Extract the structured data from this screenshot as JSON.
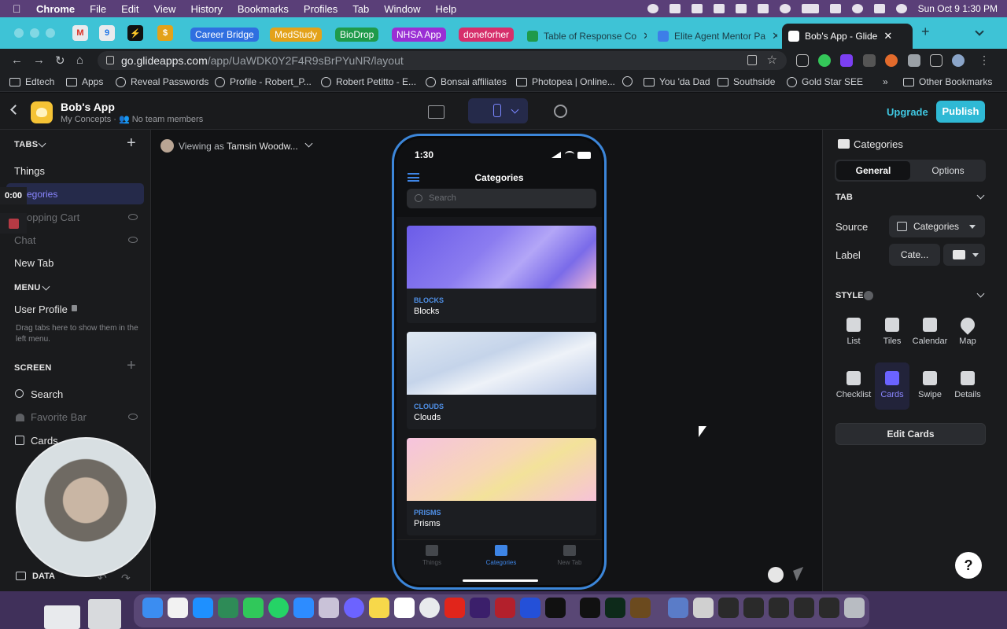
{
  "menubar": {
    "app": "Chrome",
    "items": [
      "File",
      "Edit",
      "View",
      "History",
      "Bookmarks",
      "Profiles",
      "Tab",
      "Window",
      "Help"
    ],
    "datetime": "Sun Oct 9  1:30 PM"
  },
  "tabs": {
    "groups": [
      {
        "label": "Career Bridge",
        "color": "#2f6fe0"
      },
      {
        "label": "MedStudy",
        "color": "#e3a21a"
      },
      {
        "label": "BioDrop",
        "color": "#1f9a4a"
      },
      {
        "label": "NHSA App",
        "color": "#9a2fd4"
      },
      {
        "label": "doneforher",
        "color": "#d62f6b"
      }
    ],
    "open": [
      {
        "title": "Table of Response Co",
        "color": "#1f9a4a"
      },
      {
        "title": "Elite Agent Mentor Pa",
        "color": "#3d7ee8"
      },
      {
        "title": "Bob's App - Glide",
        "color": "#ffffff"
      }
    ],
    "close_glyph": "✕",
    "new_tab_glyph": "+"
  },
  "address": {
    "host": "go.glideapps.com",
    "path": "/app/UaWDK0Y2F4R9sBrPYuNR/layout"
  },
  "bookmarks": [
    {
      "label": "Edtech",
      "icon": "folder-icon"
    },
    {
      "label": "Apps",
      "icon": "folder-icon"
    },
    {
      "label": "Reveal Passwords",
      "icon": "globe-icon"
    },
    {
      "label": "Profile - Robert_P...",
      "icon": "bolt-icon"
    },
    {
      "label": "Robert Petitto - E...",
      "icon": "bolt-icon"
    },
    {
      "label": "Bonsai affiliates",
      "icon": "leaf-icon"
    },
    {
      "label": "Photopea | Online...",
      "icon": "photopea-icon"
    },
    {
      "label": "",
      "icon": "bolt-icon"
    },
    {
      "label": "You 'da Dad",
      "icon": "folder-icon"
    },
    {
      "label": "Southside",
      "icon": "folder-icon"
    },
    {
      "label": "Gold Star SEE",
      "icon": "bolt-icon"
    }
  ],
  "bookmarks_more": "»",
  "other_bookmarks": "Other Bookmarks",
  "glide": {
    "app_name": "Bob's App",
    "subtitle": "My Concepts · 👥 No team members",
    "upgrade": "Upgrade",
    "publish": "Publish"
  },
  "sidebar": {
    "tabs_header": "TABS",
    "tabs": [
      {
        "label": "Things",
        "hidden": false
      },
      {
        "label": "egories",
        "hidden": false,
        "selected": true
      },
      {
        "label": "opping Cart",
        "hidden": true
      },
      {
        "label": "Chat",
        "hidden": true
      },
      {
        "label": "New Tab",
        "hidden": false
      }
    ],
    "menu_header": "MENU",
    "menu_items": [
      "User Profile"
    ],
    "menu_hint": "Drag tabs here to show them in the left menu.",
    "screen_header": "SCREEN",
    "screen_items": [
      {
        "label": "Search",
        "hidden": false
      },
      {
        "label": "Favorite Bar",
        "hidden": true
      },
      {
        "label": "Cards",
        "hidden": false
      }
    ],
    "data_label": "DATA",
    "timer": "0:00"
  },
  "canvas": {
    "viewing_prefix": "Viewing as",
    "viewing_user": "Tamsin Woodw..."
  },
  "phone": {
    "time": "1:30",
    "title": "Categories",
    "search_placeholder": "Search",
    "cards": [
      {
        "category": "BLOCKS",
        "name": "Blocks"
      },
      {
        "category": "CLOUDS",
        "name": "Clouds"
      },
      {
        "category": "PRISMS",
        "name": "Prisms"
      }
    ],
    "tabbar": [
      {
        "label": "Things",
        "active": false
      },
      {
        "label": "Categories",
        "active": true
      },
      {
        "label": "New Tab",
        "active": false
      }
    ]
  },
  "right_panel": {
    "title": "Categories",
    "seg_general": "General",
    "seg_options": "Options",
    "tab_section": "TAB",
    "source_label": "Source",
    "source_value": "Categories",
    "label_label": "Label",
    "label_value": "Cate...",
    "style_section": "STYLE",
    "styles": [
      {
        "label": "List",
        "selected": false
      },
      {
        "label": "Tiles",
        "selected": false
      },
      {
        "label": "Calendar",
        "selected": false
      },
      {
        "label": "Map",
        "selected": false
      },
      {
        "label": "Checklist",
        "selected": false
      },
      {
        "label": "Cards",
        "selected": true
      },
      {
        "label": "Swipe",
        "selected": false
      },
      {
        "label": "Details",
        "selected": false
      }
    ],
    "edit_button": "Edit Cards",
    "help": "?"
  }
}
